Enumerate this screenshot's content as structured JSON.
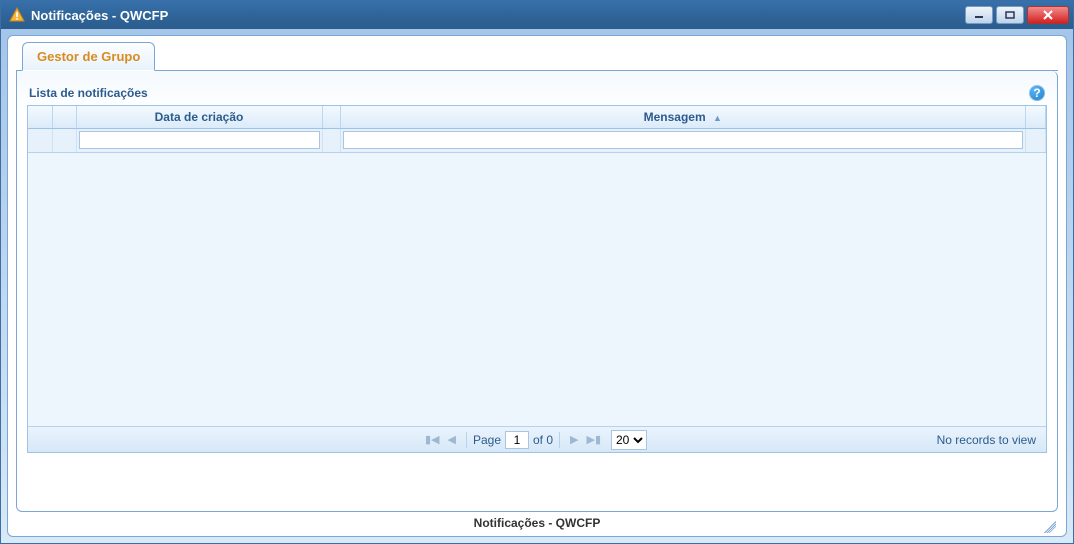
{
  "window": {
    "title": "Notificações - QWCFP"
  },
  "tab": {
    "label": "Gestor de Grupo"
  },
  "grid": {
    "caption": "Lista de notificações",
    "columns": {
      "date": "Data de criação",
      "message": "Mensagem"
    }
  },
  "pager": {
    "page_label": "Page",
    "page_value": "1",
    "of_label": "of 0",
    "page_size": "20",
    "records_text": "No records to view"
  },
  "status": {
    "text": "Notificações - QWCFP"
  }
}
